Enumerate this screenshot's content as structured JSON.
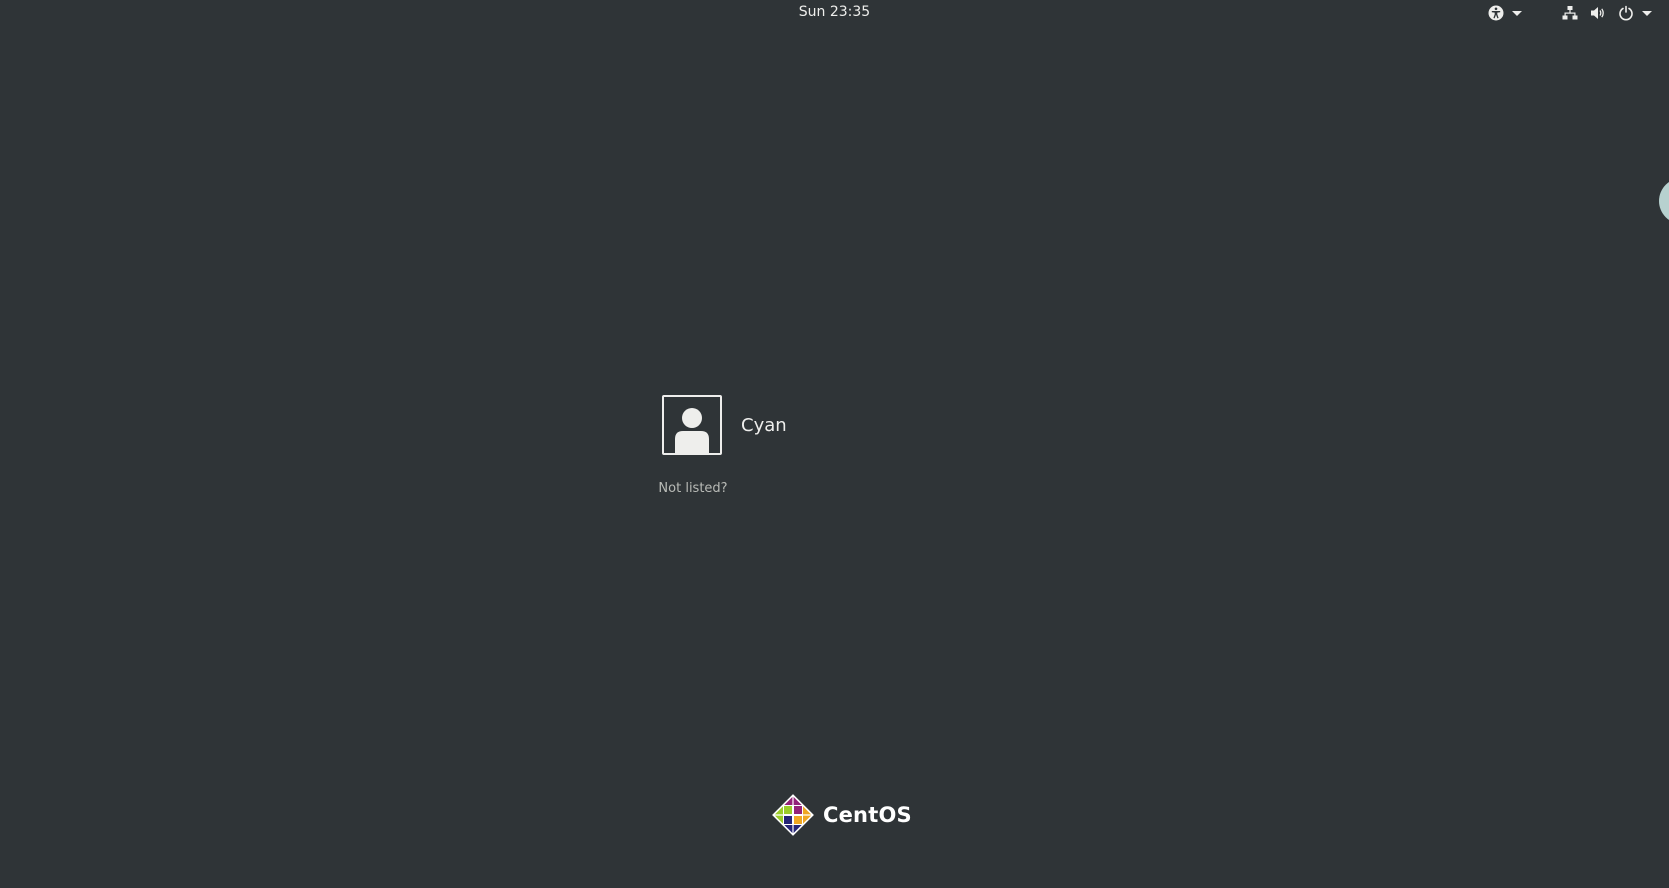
{
  "topbar": {
    "clock": "Sun 23:35",
    "icons": {
      "accessibility": "accessibility-icon",
      "network": "network-wired-icon",
      "volume": "volume-icon",
      "power": "power-icon"
    }
  },
  "login": {
    "user": {
      "name": "Cyan",
      "avatar_icon": "avatar-user-icon"
    },
    "not_listed": "Not listed?"
  },
  "branding": {
    "logo_text": "CentOS",
    "logo_icon": "centos-logo-icon"
  },
  "colors": {
    "background": "#2f3437",
    "text": "#eeeeec",
    "muted_text": "#b8bab6",
    "edge_bubble": "#b7d1cf"
  }
}
